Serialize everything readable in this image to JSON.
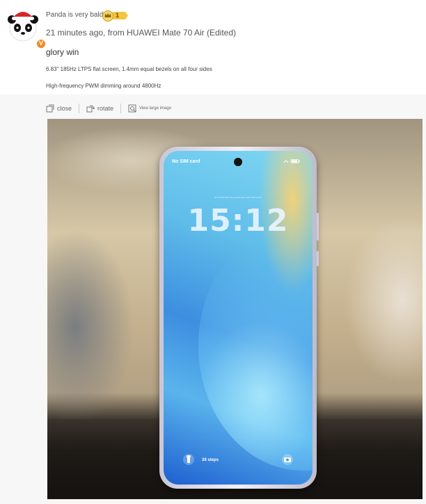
{
  "post": {
    "username": "Panda is very bald",
    "level": "1",
    "avatar_badge": "V",
    "meta": "21 minutes ago, from HUAWEI Mate 70 Air (Edited)",
    "title": "glory win",
    "lines": [
      "6.83\" 185Hz LTPS flat screen, 1.4mm equal bezels on all four sides",
      "High-frequency PWM dimming around 4800Hz"
    ]
  },
  "toolbar": {
    "close_label": "close",
    "rotate_label": "rotate",
    "view_large_label": "View large image"
  },
  "photo": {
    "no_sim": "No SIM card",
    "time": "15:12",
    "date_line": "Oct 13 Mon 8th, the seventh day of the ninth month",
    "steps": "38 steps"
  },
  "icons": {
    "close": "collapse-icon",
    "rotate": "rotate-icon",
    "view_large": "enlarge-icon",
    "level": "crown-icon"
  },
  "colors": {
    "accent_badge": "#f08a24",
    "level_gold": "#f3c640"
  }
}
